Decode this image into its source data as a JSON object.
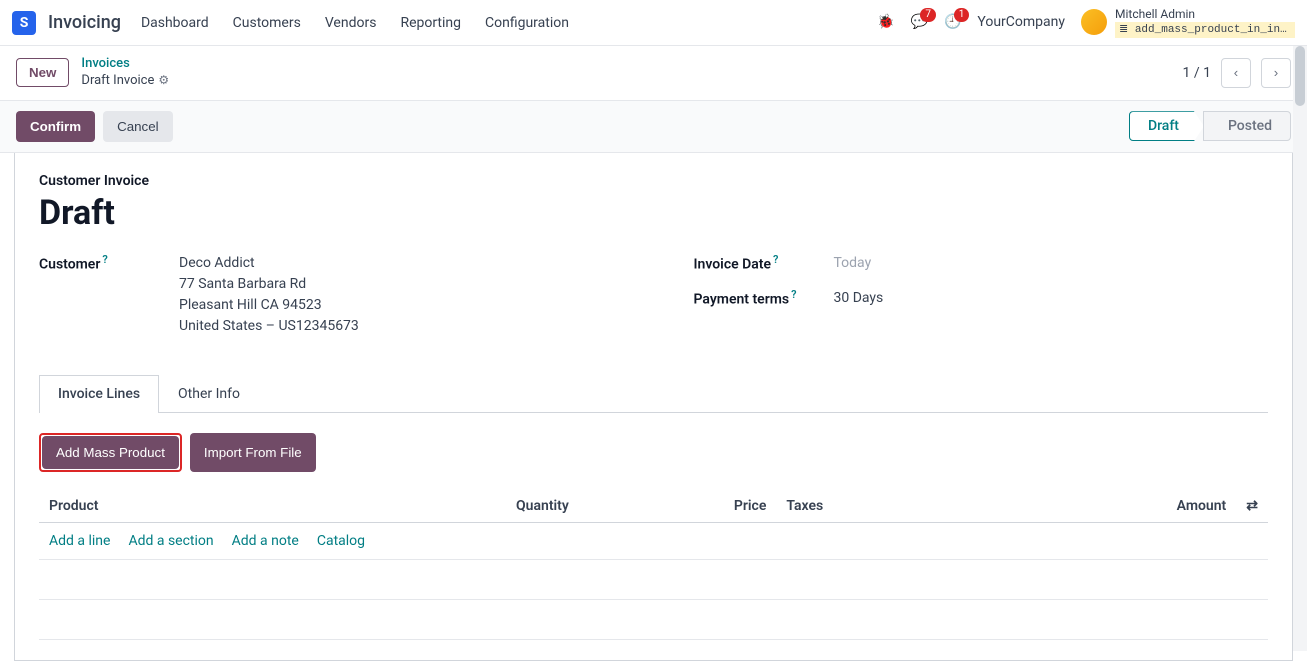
{
  "nav": {
    "app": "Invoicing",
    "items": [
      "Dashboard",
      "Customers",
      "Vendors",
      "Reporting",
      "Configuration"
    ],
    "msg_badge": "7",
    "activity_badge": "1",
    "company": "YourCompany",
    "user": "Mitchell Admin",
    "db": "add_mass_product_in_invo..."
  },
  "breadcrumb": {
    "new": "New",
    "parent": "Invoices",
    "current": "Draft Invoice",
    "pager": "1 / 1"
  },
  "statusbar": {
    "confirm": "Confirm",
    "cancel": "Cancel",
    "draft": "Draft",
    "posted": "Posted"
  },
  "sheet": {
    "subtitle": "Customer Invoice",
    "title": "Draft",
    "customer_label": "Customer",
    "customer_name": "Deco Addict",
    "customer_street": "77 Santa Barbara Rd",
    "customer_city": "Pleasant Hill CA 94523",
    "customer_country": "United States – US12345673",
    "invoice_date_label": "Invoice Date",
    "invoice_date_value": "Today",
    "payment_terms_label": "Payment terms",
    "payment_terms_value": "30 Days"
  },
  "tabs": {
    "lines": "Invoice Lines",
    "other": "Other Info"
  },
  "lines": {
    "add_mass": "Add Mass Product",
    "import_file": "Import From File",
    "cols": {
      "product": "Product",
      "quantity": "Quantity",
      "price": "Price",
      "taxes": "Taxes",
      "amount": "Amount"
    },
    "actions": {
      "add_line": "Add a line",
      "add_section": "Add a section",
      "add_note": "Add a note",
      "catalog": "Catalog"
    }
  }
}
